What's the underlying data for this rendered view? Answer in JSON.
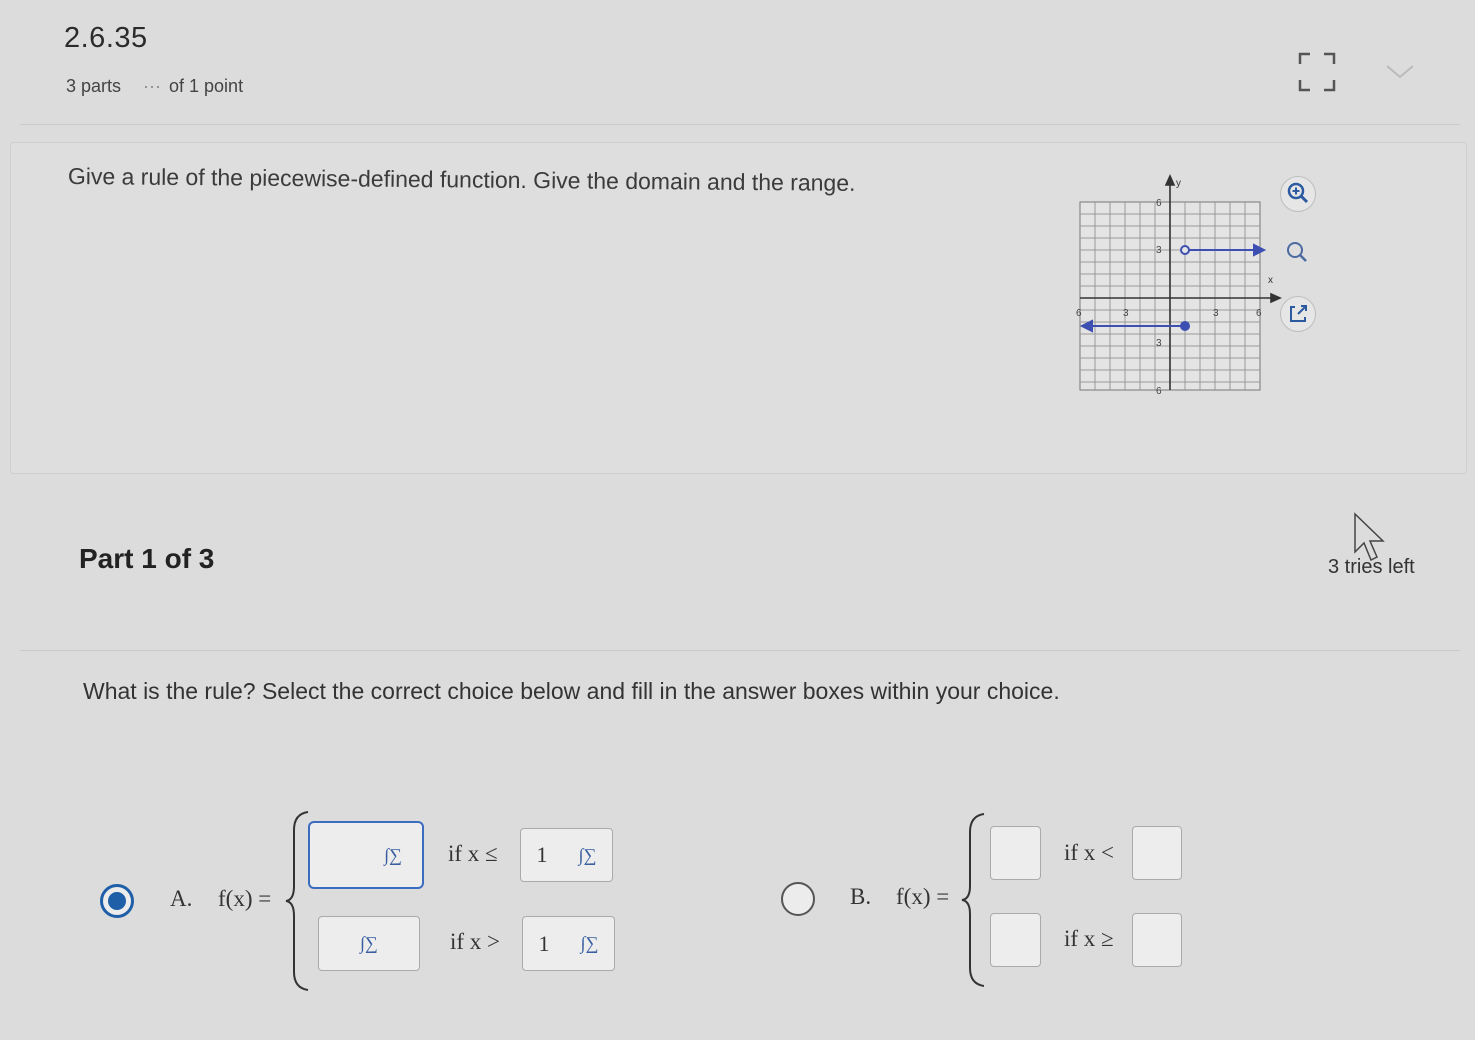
{
  "header": {
    "problem_id": "2.6.35",
    "parts": "3 parts",
    "dots": "···",
    "points": "of 1 point"
  },
  "question": {
    "text": "Give a rule of the piecewise-defined function. Give the domain and the range."
  },
  "graph": {
    "y_axis_label": "y",
    "x_axis_label": "x",
    "tick_labels": {
      "y_top": "6",
      "y_upper": "3",
      "x_left_outer": "6",
      "x_left": "3",
      "x_right": "3",
      "x_right_outer": "6",
      "y_lower": "3",
      "y_bottom": "6"
    },
    "series_color": "#3d4fb0"
  },
  "tools": [
    "zoom-in-icon",
    "zoom-out-icon",
    "popout-icon"
  ],
  "part": {
    "label": "Part 1 of 3",
    "tries": "3 tries left"
  },
  "prompt": "What is the rule? Select the correct choice below and fill in the answer boxes within your choice.",
  "choices": [
    {
      "letter": "A.",
      "selected": true,
      "lhs": "f(x) =",
      "rows": [
        {
          "cond": "if x ≤",
          "value": "1"
        },
        {
          "cond": "if x >",
          "value": "1"
        }
      ],
      "math_tool_glyph": "∫∑"
    },
    {
      "letter": "B.",
      "selected": false,
      "lhs": "f(x) =",
      "rows": [
        {
          "cond": "if x <"
        },
        {
          "cond": "if x ≥"
        }
      ]
    }
  ]
}
